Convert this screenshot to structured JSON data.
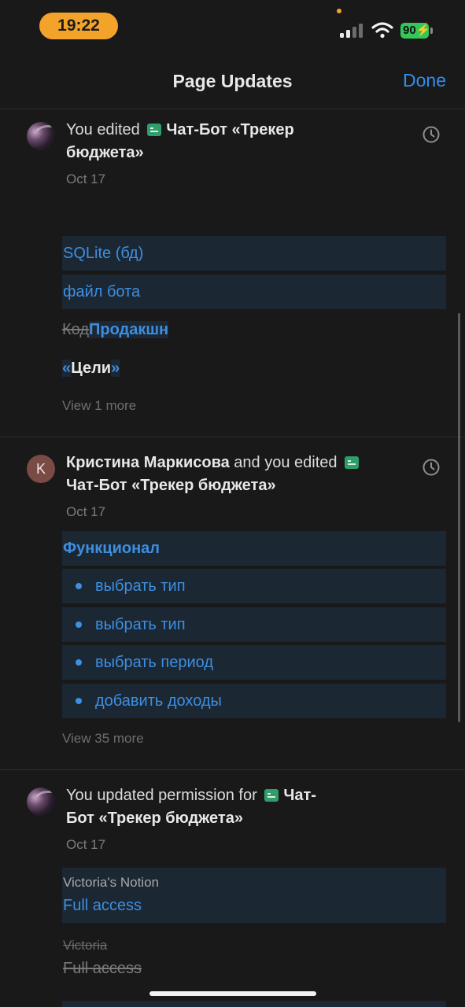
{
  "status_bar": {
    "time": "19:22",
    "battery": "90"
  },
  "header": {
    "title": "Page Updates",
    "done_label": "Done"
  },
  "updates": [
    {
      "actor": "You",
      "action": "edited",
      "page": "Чат-Бот «Трекер бюджета»",
      "date": "Oct 17",
      "rows": {
        "sqlite": "SQLite (бд)",
        "bot_file": "файл бота",
        "removed_word": "Код",
        "added_word": "Продакшн",
        "quote_open": "«",
        "goals": "Цели",
        "quote_close": "»"
      },
      "view_more": "View 1 more"
    },
    {
      "actor": "Кристина Маркисова",
      "action": "and you edited",
      "avatar_letter": "K",
      "page": "Чат-Бот «Трекер бюджета»",
      "date": "Oct 17",
      "heading": "Функционал",
      "bullets": [
        "выбрать тип",
        "выбрать тип",
        "выбрать период",
        "добавить доходы"
      ],
      "view_more": "View 35 more"
    },
    {
      "actor": "You",
      "action": "updated permission for",
      "page_part1": "Чат-",
      "page_part2": "Бот «Трекер бюджета»",
      "date": "Oct 17",
      "new_permission": {
        "workspace": "Victoria's Notion",
        "access": "Full access"
      },
      "old_permission": {
        "workspace": "Victoria",
        "access": "Full access"
      }
    }
  ],
  "colors": {
    "background": "#191919",
    "accent": "#2f8ff0",
    "highlight_bg": "#1c2734",
    "page_icon": "#2f9e6b",
    "time_pill": "#f4a32a",
    "battery": "#34c759"
  },
  "icons": {
    "history": "clock-icon",
    "page": "page-icon",
    "wifi": "wifi-icon",
    "signal": "cellular-signal-icon"
  }
}
